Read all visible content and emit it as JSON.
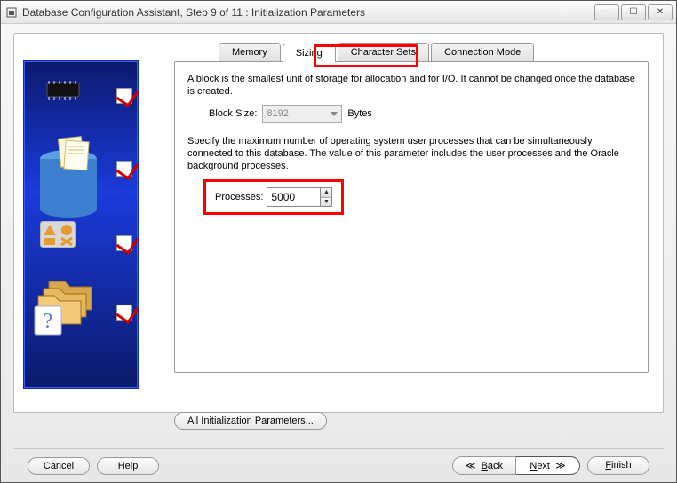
{
  "window": {
    "title": "Database Configuration Assistant, Step 9 of 11 : Initialization Parameters"
  },
  "tabs": {
    "memory": "Memory",
    "sizing": "Sizing",
    "charsets": "Character Sets",
    "connmode": "Connection Mode",
    "active": "sizing"
  },
  "sizing": {
    "block_desc": "A block is the smallest unit of storage for allocation and for I/O. It cannot be changed once the database is created.",
    "block_size_label": "Block Size:",
    "block_size_value": "8192",
    "block_size_unit": "Bytes",
    "process_desc": "Specify the maximum number of operating system user processes that can be simultaneously connected to this database. The value of this parameter includes the user processes and the Oracle background processes.",
    "processes_label": "Processes:",
    "processes_value": "5000"
  },
  "buttons": {
    "all_params": "All Initialization Parameters...",
    "cancel": "Cancel",
    "help": "Help",
    "back": "Back",
    "next": "Next",
    "finish": "Finish"
  },
  "win_controls": {
    "minimize": "—",
    "maximize": "☐",
    "close": "✕"
  }
}
